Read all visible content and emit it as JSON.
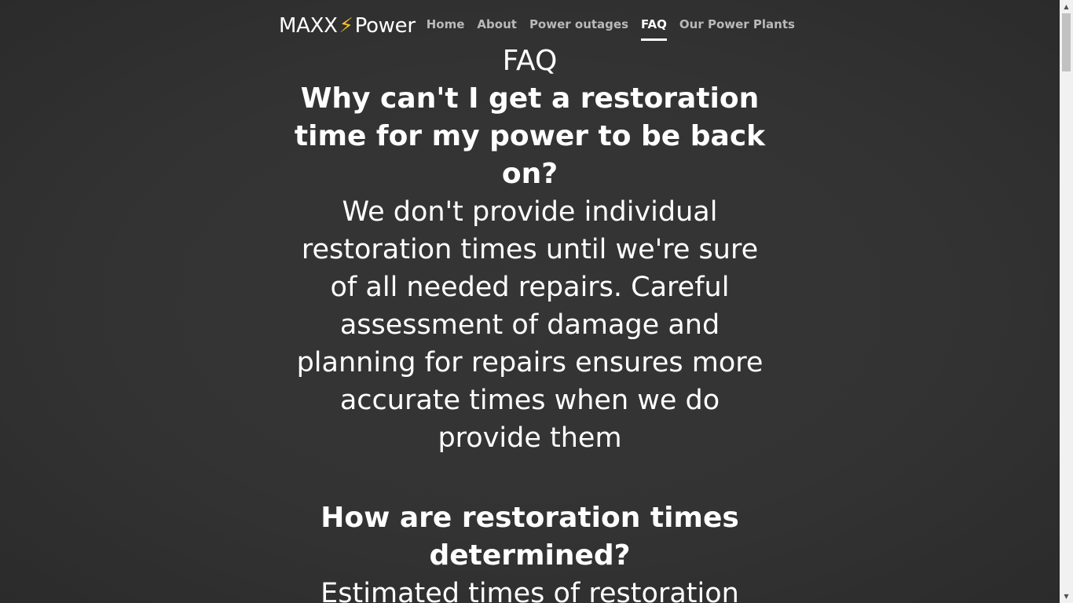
{
  "nav": {
    "brand_prefix": "MAXX",
    "brand_bolt": "⚡",
    "brand_suffix": "Power",
    "links": [
      {
        "label": "Home"
      },
      {
        "label": "About"
      },
      {
        "label": "Power outages"
      },
      {
        "label": "FAQ",
        "active": true
      },
      {
        "label": "Our Power Plants"
      }
    ]
  },
  "page": {
    "title": "FAQ"
  },
  "faq": [
    {
      "question": "Why can't I get a restoration time for my power to be back on?",
      "answer": "We don't provide individual restoration times until we're sure of all needed repairs. Careful assessment of damage and planning for repairs ensures more accurate times when we do provide them"
    },
    {
      "question": "How are restoration times determined?",
      "answer": "Estimated times of restoration"
    }
  ],
  "colors": {
    "background": "#333333",
    "text": "#ffffff",
    "nav_inactive": "#b9b9b9",
    "bolt": "#f2c12e"
  }
}
